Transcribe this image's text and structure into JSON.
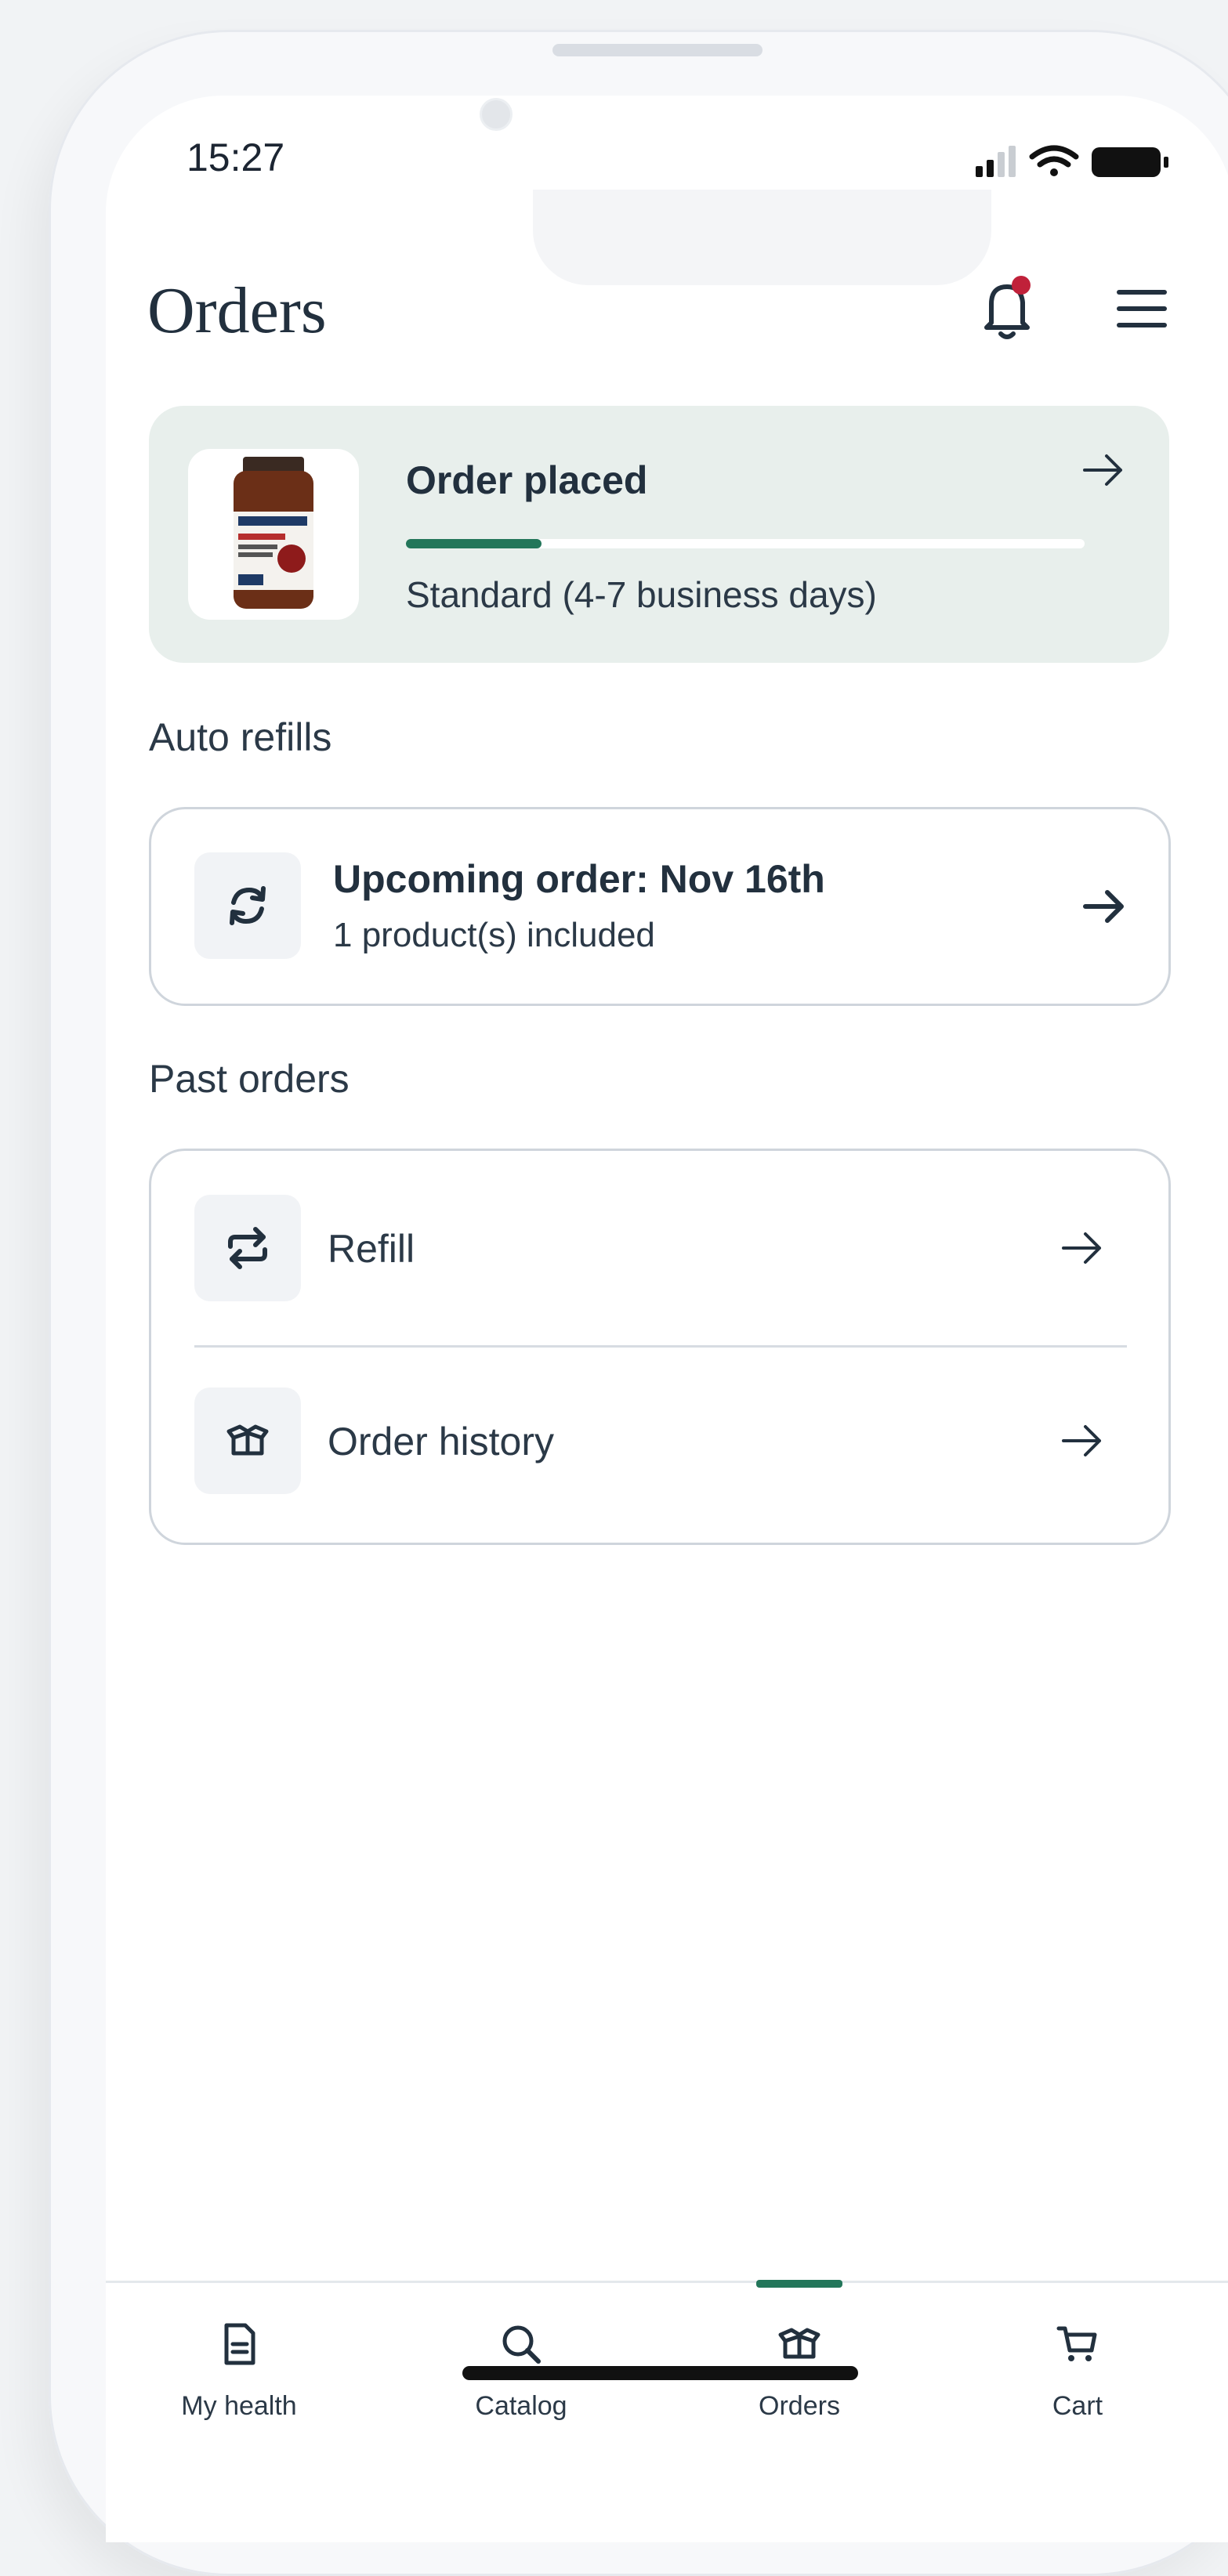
{
  "status_bar": {
    "time": "15:27"
  },
  "header": {
    "title": "Orders",
    "notification_icon": "bell-icon",
    "menu_icon": "hamburger-menu-icon"
  },
  "current_order": {
    "status": "Order placed",
    "progress_fraction": 0.2,
    "shipping": "Standard (4-7 business days)",
    "product_image": "supplement-bottle",
    "arrow_icon": "arrow-right-icon"
  },
  "auto_refills": {
    "heading": "Auto refills",
    "upcoming_title": "Upcoming order: Nov 16th",
    "upcoming_subtitle": "1 product(s) included",
    "icon": "refresh-icon"
  },
  "past_orders": {
    "heading": "Past orders",
    "items": [
      {
        "label": "Refill",
        "icon": "repeat-icon"
      },
      {
        "label": "Order history",
        "icon": "open-box-icon"
      }
    ]
  },
  "tab_bar": {
    "tabs": [
      {
        "label": "My health",
        "icon": "document-icon"
      },
      {
        "label": "Catalog",
        "icon": "search-icon"
      },
      {
        "label": "Orders",
        "icon": "open-box-icon",
        "active": true
      },
      {
        "label": "Cart",
        "icon": "cart-icon"
      }
    ]
  },
  "colors": {
    "accent": "#23765a",
    "card_bg": "#e8efec",
    "notification_dot": "#c0213a",
    "text": "#22303e"
  }
}
